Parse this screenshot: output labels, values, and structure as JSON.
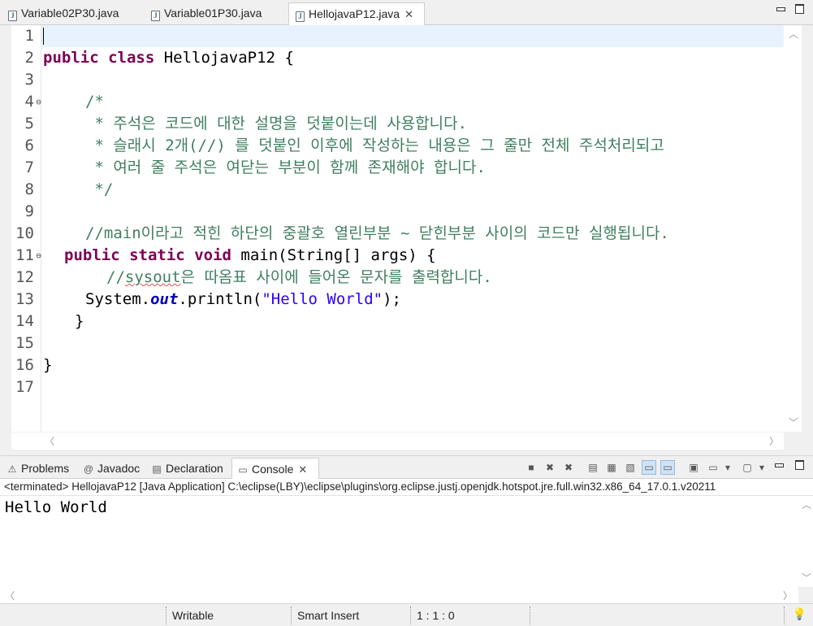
{
  "editor_tabs": [
    {
      "label": "Variable02P30.java"
    },
    {
      "label": "Variable01P30.java"
    },
    {
      "label": "HellojavaP12.java"
    }
  ],
  "editor": {
    "line_numbers": [
      "1",
      "2",
      "3",
      "4",
      "5",
      "6",
      "7",
      "8",
      "9",
      "10",
      "11",
      "12",
      "13",
      "14",
      "15",
      "16",
      "17"
    ],
    "fold_markers": {
      "4": "⊖",
      "11": "⊖"
    },
    "code": {
      "class_kw1": "public",
      "class_kw2": "class",
      "class_rest": " HellojavaP12 {",
      "l4": "/*",
      "l5": " * 주석은 코드에 대한 설명을 덧붙이는데 사용합니다.",
      "l6": " * 슬래시 2개(//) 를 덧붙인 이후에 작성하는 내용은 그 줄만 전체 주석처리되고",
      "l7": " * 여러 줄 주석은 여닫는 부분이 함께 존재해야 합니다.",
      "l8": " */",
      "l10": "//main이라고 적힌 하단의 중괄호 열린부분 ~ 닫힌부분 사이의 코드만 실행됩니다.",
      "l11_kw1": "public",
      "l11_kw2": "static",
      "l11_kw3": "void",
      "l11_rest": " main(String[] args) {",
      "l12_prefix": "//",
      "l12_sysout": "sysout",
      "l12_rest": "은 따옴표 사이에 들어온 문자를 출력합니다.",
      "l13_a": "System.",
      "l13_out": "out",
      "l13_b": ".println(",
      "l13_str": "\"Hello World\"",
      "l13_c": ");",
      "l14": "}",
      "l16": "}"
    }
  },
  "panel_tabs": [
    {
      "label": "Problems",
      "icon": "problems-icon"
    },
    {
      "label": "Javadoc",
      "icon": "javadoc-icon"
    },
    {
      "label": "Declaration",
      "icon": "declaration-icon"
    },
    {
      "label": "Console",
      "icon": "console-icon"
    }
  ],
  "console": {
    "info": "<terminated> HellojavaP12 [Java Application] C:\\eclipse(LBY)\\eclipse\\plugins\\org.eclipse.justj.openjdk.hotspot.jre.full.win32.x86_64_17.0.1.v20211",
    "output": "Hello World"
  },
  "status": {
    "writable": "Writable",
    "insert_mode": "Smart Insert",
    "position": "1 : 1 : 0"
  }
}
